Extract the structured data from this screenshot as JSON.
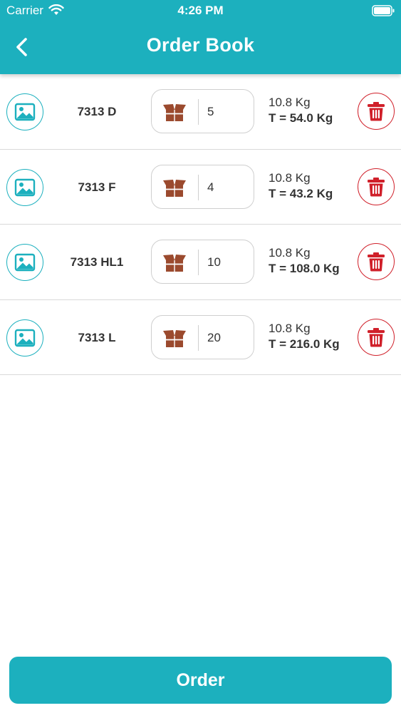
{
  "status_bar": {
    "carrier": "Carrier",
    "time": "4:26 PM"
  },
  "header": {
    "title": "Order Book",
    "back_icon": "chevron-left-icon"
  },
  "colors": {
    "accent": "#1cb0be",
    "delete": "#d0202a",
    "box": "#9b4a2e"
  },
  "items": [
    {
      "code": "7313 D",
      "quantity": "5",
      "unit_weight": "10.8 Kg",
      "total_weight": "T = 54.0 Kg"
    },
    {
      "code": "7313 F",
      "quantity": "4",
      "unit_weight": "10.8 Kg",
      "total_weight": "T = 43.2 Kg"
    },
    {
      "code": "7313 HL1",
      "quantity": "10",
      "unit_weight": "10.8 Kg",
      "total_weight": "T = 108.0 Kg"
    },
    {
      "code": "7313 L",
      "quantity": "20",
      "unit_weight": "10.8 Kg",
      "total_weight": "T = 216.0 Kg"
    }
  ],
  "footer": {
    "order_label": "Order"
  }
}
